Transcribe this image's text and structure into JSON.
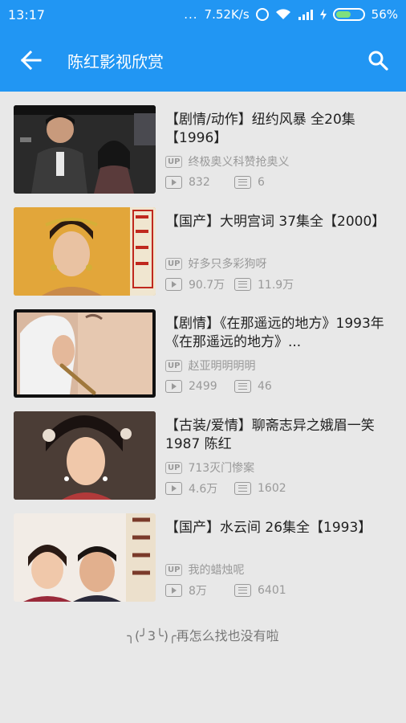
{
  "status_bar": {
    "time": "13:17",
    "dots": "...",
    "net_speed": "7.52K/s",
    "battery": "56%",
    "icons": [
      "alarm-icon",
      "wifi-icon",
      "signal-icon",
      "charging-icon",
      "battery-icon"
    ]
  },
  "app_bar": {
    "title": "陈红影视欣赏",
    "back_icon": "arrow-left-icon",
    "search_icon": "search-icon",
    "color": "#2196f3"
  },
  "videos": [
    {
      "title": "【剧情/动作】纽约风暴 全20集【1996】",
      "up_badge": "UP",
      "uploader": "终极奥义科赞抢奥义",
      "views": "832",
      "danmaku": "6"
    },
    {
      "title": "【国产】大明宫词 37集全【2000】",
      "up_badge": "UP",
      "uploader": "好多只多彩狗呀",
      "views": "90.7万",
      "danmaku": "11.9万"
    },
    {
      "title": "【剧情】《在那遥远的地方》1993年《在那遥远的地方》...",
      "up_badge": "UP",
      "uploader": "赵亚明明明明",
      "views": "2499",
      "danmaku": "46"
    },
    {
      "title": "【古装/爱情】聊斋志异之娥眉一笑1987 陈红",
      "up_badge": "UP",
      "uploader": "713灭门惨案",
      "views": "4.6万",
      "danmaku": "1602"
    },
    {
      "title": "【国产】水云间 26集全【1993】",
      "up_badge": "UP",
      "uploader": "我的蜡烛呢",
      "views": "8万",
      "danmaku": "6401"
    }
  ],
  "end_message": "╮(╯3╰)╭再怎么找也没有啦"
}
